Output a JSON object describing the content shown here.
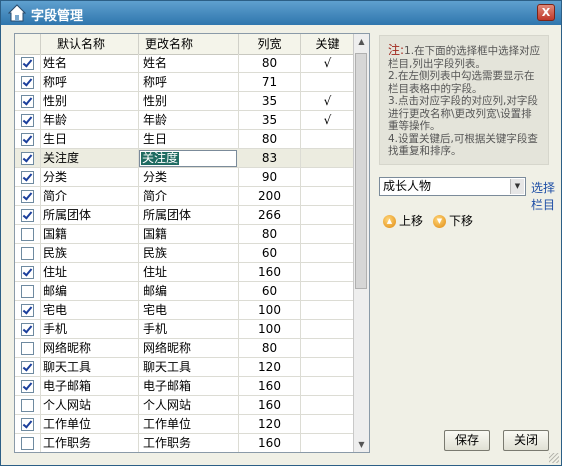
{
  "window": {
    "title": "字段管理",
    "close_glyph": "X"
  },
  "grid": {
    "headers": {
      "default_name": "默认名称",
      "changed_name": "更改名称",
      "width": "列宽",
      "key": "关键"
    },
    "rows": [
      {
        "checked": true,
        "default": "姓名",
        "changed": "姓名",
        "width": "80",
        "key": "√"
      },
      {
        "checked": true,
        "default": "称呼",
        "changed": "称呼",
        "width": "71",
        "key": ""
      },
      {
        "checked": true,
        "default": "性别",
        "changed": "性别",
        "width": "35",
        "key": "√"
      },
      {
        "checked": true,
        "default": "年龄",
        "changed": "年龄",
        "width": "35",
        "key": "√"
      },
      {
        "checked": true,
        "default": "生日",
        "changed": "生日",
        "width": "80",
        "key": ""
      },
      {
        "checked": true,
        "default": "关注度",
        "changed": "关注度",
        "width": "83",
        "key": ""
      },
      {
        "checked": true,
        "default": "分类",
        "changed": "分类",
        "width": "90",
        "key": ""
      },
      {
        "checked": true,
        "default": "简介",
        "changed": "简介",
        "width": "200",
        "key": ""
      },
      {
        "checked": true,
        "default": "所属团体",
        "changed": "所属团体",
        "width": "266",
        "key": ""
      },
      {
        "checked": false,
        "default": "国籍",
        "changed": "国籍",
        "width": "80",
        "key": ""
      },
      {
        "checked": false,
        "default": "民族",
        "changed": "民族",
        "width": "60",
        "key": ""
      },
      {
        "checked": true,
        "default": "住址",
        "changed": "住址",
        "width": "160",
        "key": ""
      },
      {
        "checked": false,
        "default": "邮编",
        "changed": "邮编",
        "width": "60",
        "key": ""
      },
      {
        "checked": true,
        "default": "宅电",
        "changed": "宅电",
        "width": "100",
        "key": ""
      },
      {
        "checked": true,
        "default": "手机",
        "changed": "手机",
        "width": "100",
        "key": ""
      },
      {
        "checked": false,
        "default": "网络昵称",
        "changed": "网络昵称",
        "width": "80",
        "key": ""
      },
      {
        "checked": true,
        "default": "聊天工具",
        "changed": "聊天工具",
        "width": "120",
        "key": ""
      },
      {
        "checked": true,
        "default": "电子邮箱",
        "changed": "电子邮箱",
        "width": "160",
        "key": ""
      },
      {
        "checked": false,
        "default": "个人网站",
        "changed": "个人网站",
        "width": "160",
        "key": ""
      },
      {
        "checked": true,
        "default": "工作单位",
        "changed": "工作单位",
        "width": "120",
        "key": ""
      },
      {
        "checked": false,
        "default": "工作职务",
        "changed": "工作职务",
        "width": "160",
        "key": ""
      }
    ],
    "editing_row": 5,
    "editing_value": "关注度"
  },
  "note": {
    "label": "注:",
    "lines": [
      "1.在下面的选择框中选择对应栏目,列出字段列表。",
      "2.在左侧列表中勾选需要显示在栏目表格中的字段。",
      "3.点击对应字段的对应列,对字段进行更改名称\\更改列宽\\设置排重等操作。",
      "4.设置关键后,可根据关键字段查找重复和排序。"
    ]
  },
  "column_select": {
    "value": "成长人物",
    "link_label": "选择栏目"
  },
  "move": {
    "up_label": "上移",
    "down_label": "下移"
  },
  "buttons": {
    "save": "保存",
    "close": "关闭"
  },
  "icons": {
    "title": "house-icon",
    "up": "arrow-up-icon",
    "down": "arrow-down-icon"
  }
}
